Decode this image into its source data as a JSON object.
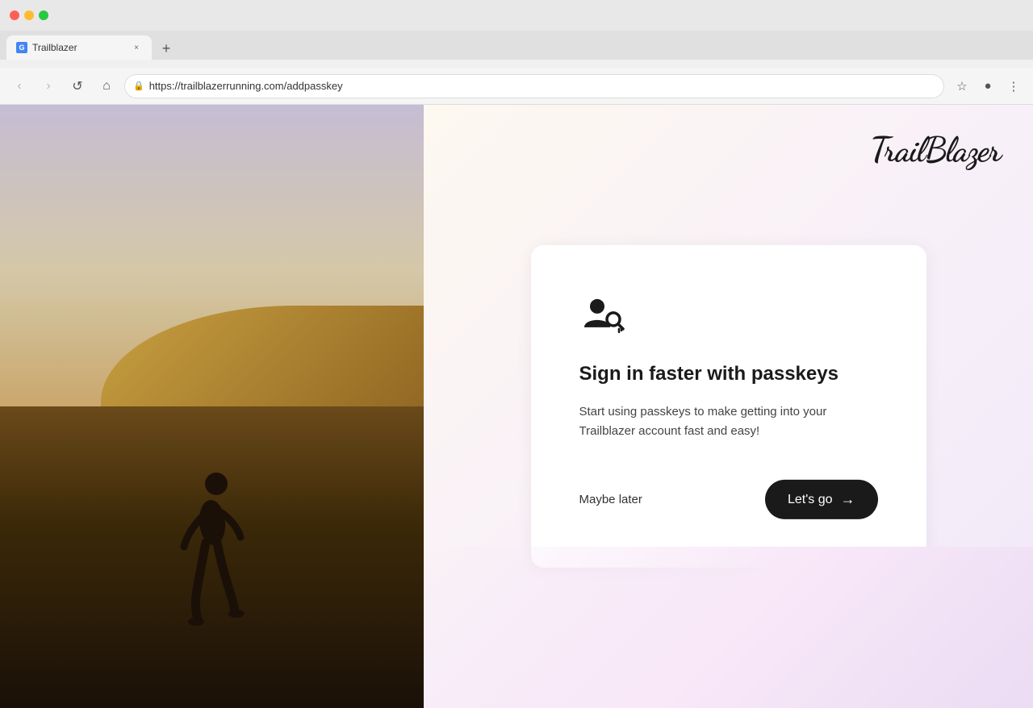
{
  "browser": {
    "tab_title": "Trailblazer",
    "tab_favicon": "G",
    "url": "https://trailblazerrunning.com/addpasskey",
    "close_symbol": "×",
    "new_tab_symbol": "+",
    "back_symbol": "‹",
    "forward_symbol": "›",
    "reload_symbol": "↺",
    "home_symbol": "⌂",
    "bookmark_symbol": "☆",
    "profile_symbol": "●",
    "menu_symbol": "⋮",
    "lock_symbol": "🔒"
  },
  "logo": {
    "text": "TrailBlazer"
  },
  "card": {
    "title": "Sign in faster with passkeys",
    "description": "Start using passkeys to make getting into your Trailblazer account fast and easy!",
    "maybe_later_label": "Maybe later",
    "lets_go_label": "Let's go"
  }
}
